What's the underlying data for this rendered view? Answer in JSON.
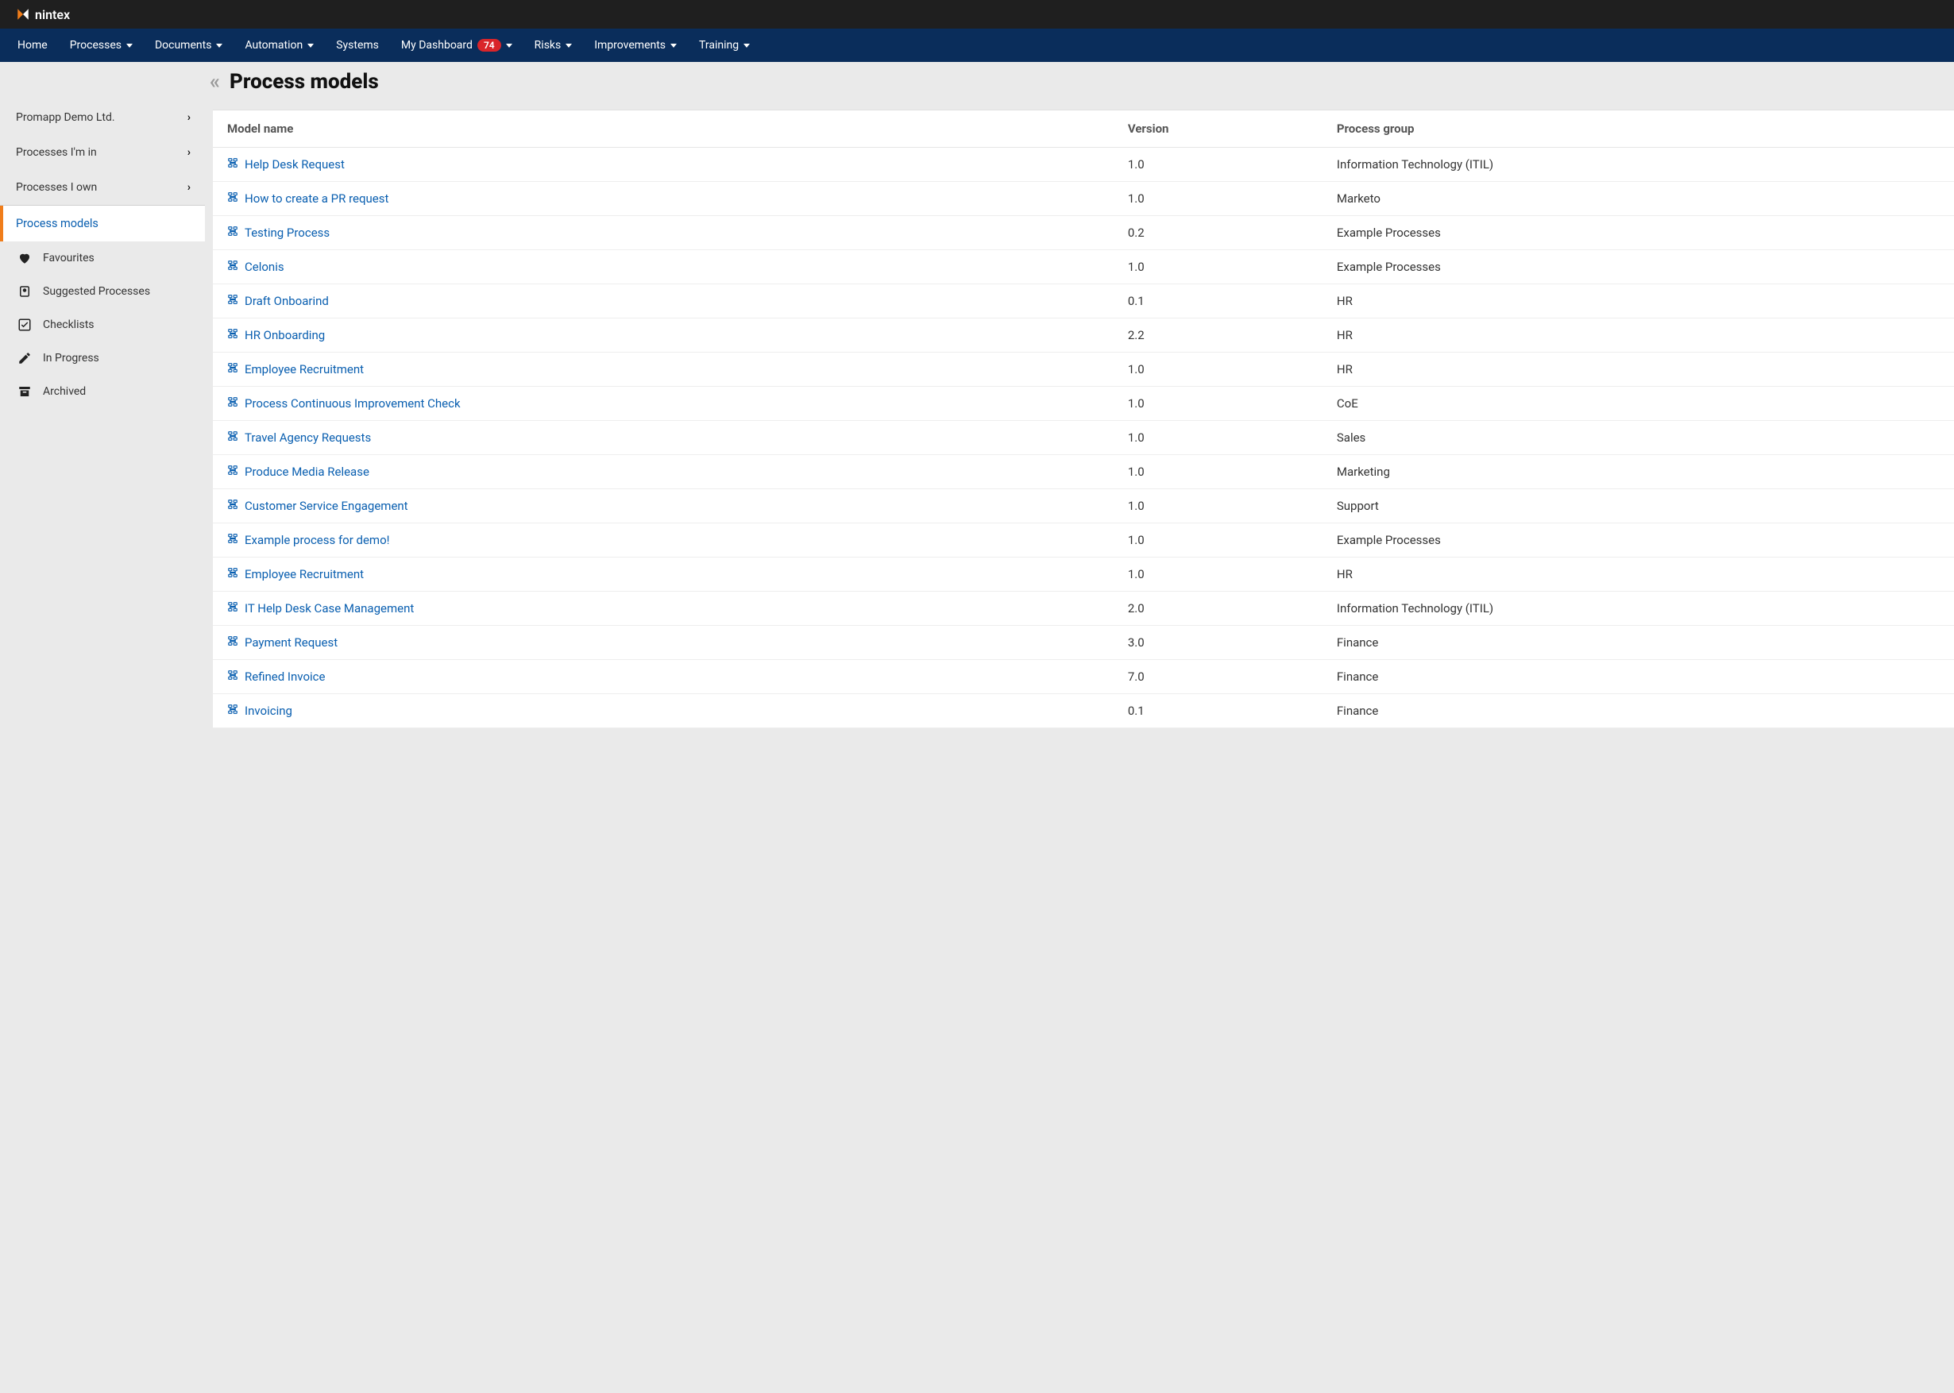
{
  "brand": "nintex",
  "nav": {
    "home": "Home",
    "processes": "Processes",
    "documents": "Documents",
    "automation": "Automation",
    "systems": "Systems",
    "my_dashboard": "My Dashboard",
    "my_dashboard_badge": "74",
    "risks": "Risks",
    "improvements": "Improvements",
    "training": "Training"
  },
  "sidebar": {
    "org": "Promapp Demo Ltd.",
    "processes_in": "Processes I'm in",
    "processes_own": "Processes I own",
    "process_models": "Process models",
    "favourites": "Favourites",
    "suggested": "Suggested Processes",
    "checklists": "Checklists",
    "in_progress": "In Progress",
    "archived": "Archived"
  },
  "page": {
    "title": "Process models"
  },
  "table": {
    "headers": {
      "model_name": "Model name",
      "version": "Version",
      "process_group": "Process group"
    },
    "rows": [
      {
        "name": "Help Desk Request",
        "version": "1.0",
        "group": "Information Technology (ITIL)"
      },
      {
        "name": "How to create a PR request",
        "version": "1.0",
        "group": "Marketo"
      },
      {
        "name": "Testing Process",
        "version": "0.2",
        "group": "Example Processes"
      },
      {
        "name": "Celonis",
        "version": "1.0",
        "group": "Example Processes"
      },
      {
        "name": "Draft Onboarind",
        "version": "0.1",
        "group": "HR"
      },
      {
        "name": "HR Onboarding",
        "version": "2.2",
        "group": "HR"
      },
      {
        "name": "Employee Recruitment",
        "version": "1.0",
        "group": "HR"
      },
      {
        "name": "Process Continuous Improvement Check",
        "version": "1.0",
        "group": "CoE"
      },
      {
        "name": "Travel Agency Requests",
        "version": "1.0",
        "group": "Sales"
      },
      {
        "name": "Produce Media Release",
        "version": "1.0",
        "group": "Marketing"
      },
      {
        "name": "Customer Service Engagement",
        "version": "1.0",
        "group": "Support"
      },
      {
        "name": "Example process for demo!",
        "version": "1.0",
        "group": "Example Processes"
      },
      {
        "name": "Employee Recruitment",
        "version": "1.0",
        "group": "HR"
      },
      {
        "name": "IT Help Desk Case Management",
        "version": "2.0",
        "group": "Information Technology (ITIL)"
      },
      {
        "name": "Payment Request",
        "version": "3.0",
        "group": "Finance"
      },
      {
        "name": "Refined Invoice",
        "version": "7.0",
        "group": "Finance"
      },
      {
        "name": "Invoicing",
        "version": "0.1",
        "group": "Finance"
      }
    ]
  }
}
